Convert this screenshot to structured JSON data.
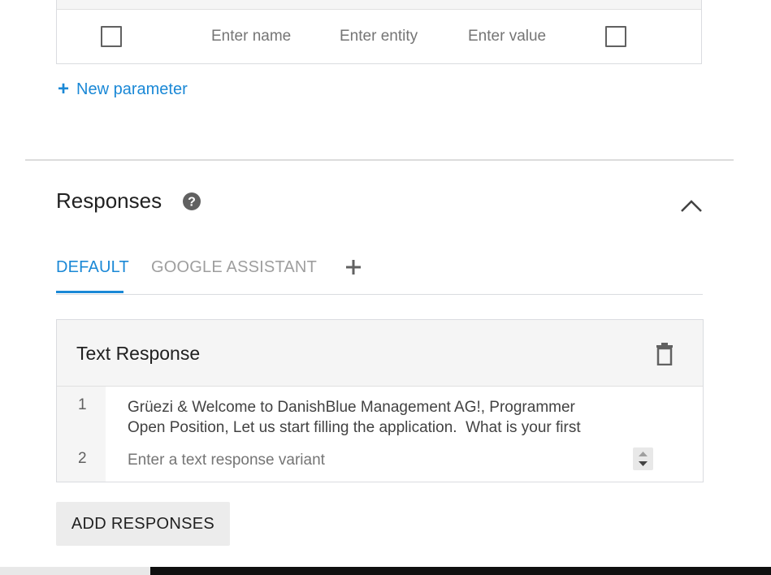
{
  "parameters": {
    "row": {
      "name_placeholder": "Enter name",
      "entity_placeholder": "Enter entity",
      "value_placeholder": "Enter value"
    },
    "new_parameter_label": "New parameter",
    "new_parameter_icon": "plus-icon"
  },
  "responses": {
    "title": "Responses",
    "help_icon": "help-circle-icon",
    "collapse_icon": "chevron-up-icon",
    "tabs": [
      {
        "label": "DEFAULT",
        "active": true
      },
      {
        "label": "GOOGLE ASSISTANT",
        "active": false
      }
    ],
    "add_tab_icon": "plus-icon",
    "card": {
      "title": "Text Response",
      "delete_icon": "trash-icon",
      "lines": [
        {
          "number": "1",
          "text": "Grüezi & Welcome to DanishBlue Management AG!, Programmer\nOpen Position, Let us start filling the application.  What is your first"
        },
        {
          "number": "2",
          "placeholder": "Enter a text response variant"
        }
      ]
    },
    "add_responses_label": "ADD RESPONSES"
  },
  "colors": {
    "accent": "#1a88d6",
    "muted": "#9e9e9e",
    "header_bg": "#f5f5f5"
  }
}
